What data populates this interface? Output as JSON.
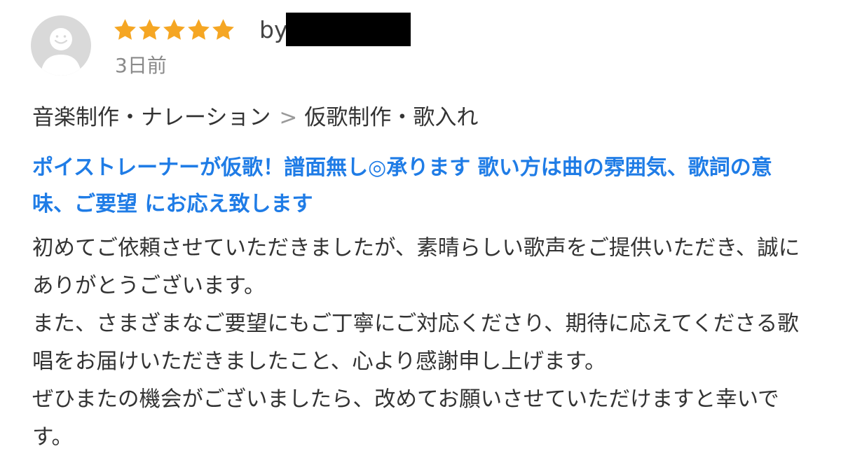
{
  "review": {
    "rating": 5,
    "rating_max": 5,
    "star_color": "#f5a623",
    "reviewer_prefix": "by",
    "posted": "3日前"
  },
  "breadcrumb": {
    "category": "音楽制作・ナレーション",
    "separator": ">",
    "subcategory": "仮歌制作・歌入れ"
  },
  "service": {
    "title": "ポイストレーナーが仮歌！譜面無し◎承ります 歌い方は曲の雰囲気、歌詞の意味、ご要望 にお応え致します",
    "title_color": "#1f7ce6"
  },
  "body": {
    "paragraphs": [
      "初めてご依頼させていただきましたが、素晴らしい歌声をご提供いただき、誠にありがとうございます。",
      "また、さまざまなご要望にもご丁寧にご対応くださり、期待に応えてくださる歌唱をお届けいただきましたこと、心より感謝申し上げます。",
      "ぜひまたの機会がございましたら、改めてお願いさせていただけますと幸いです。"
    ]
  }
}
